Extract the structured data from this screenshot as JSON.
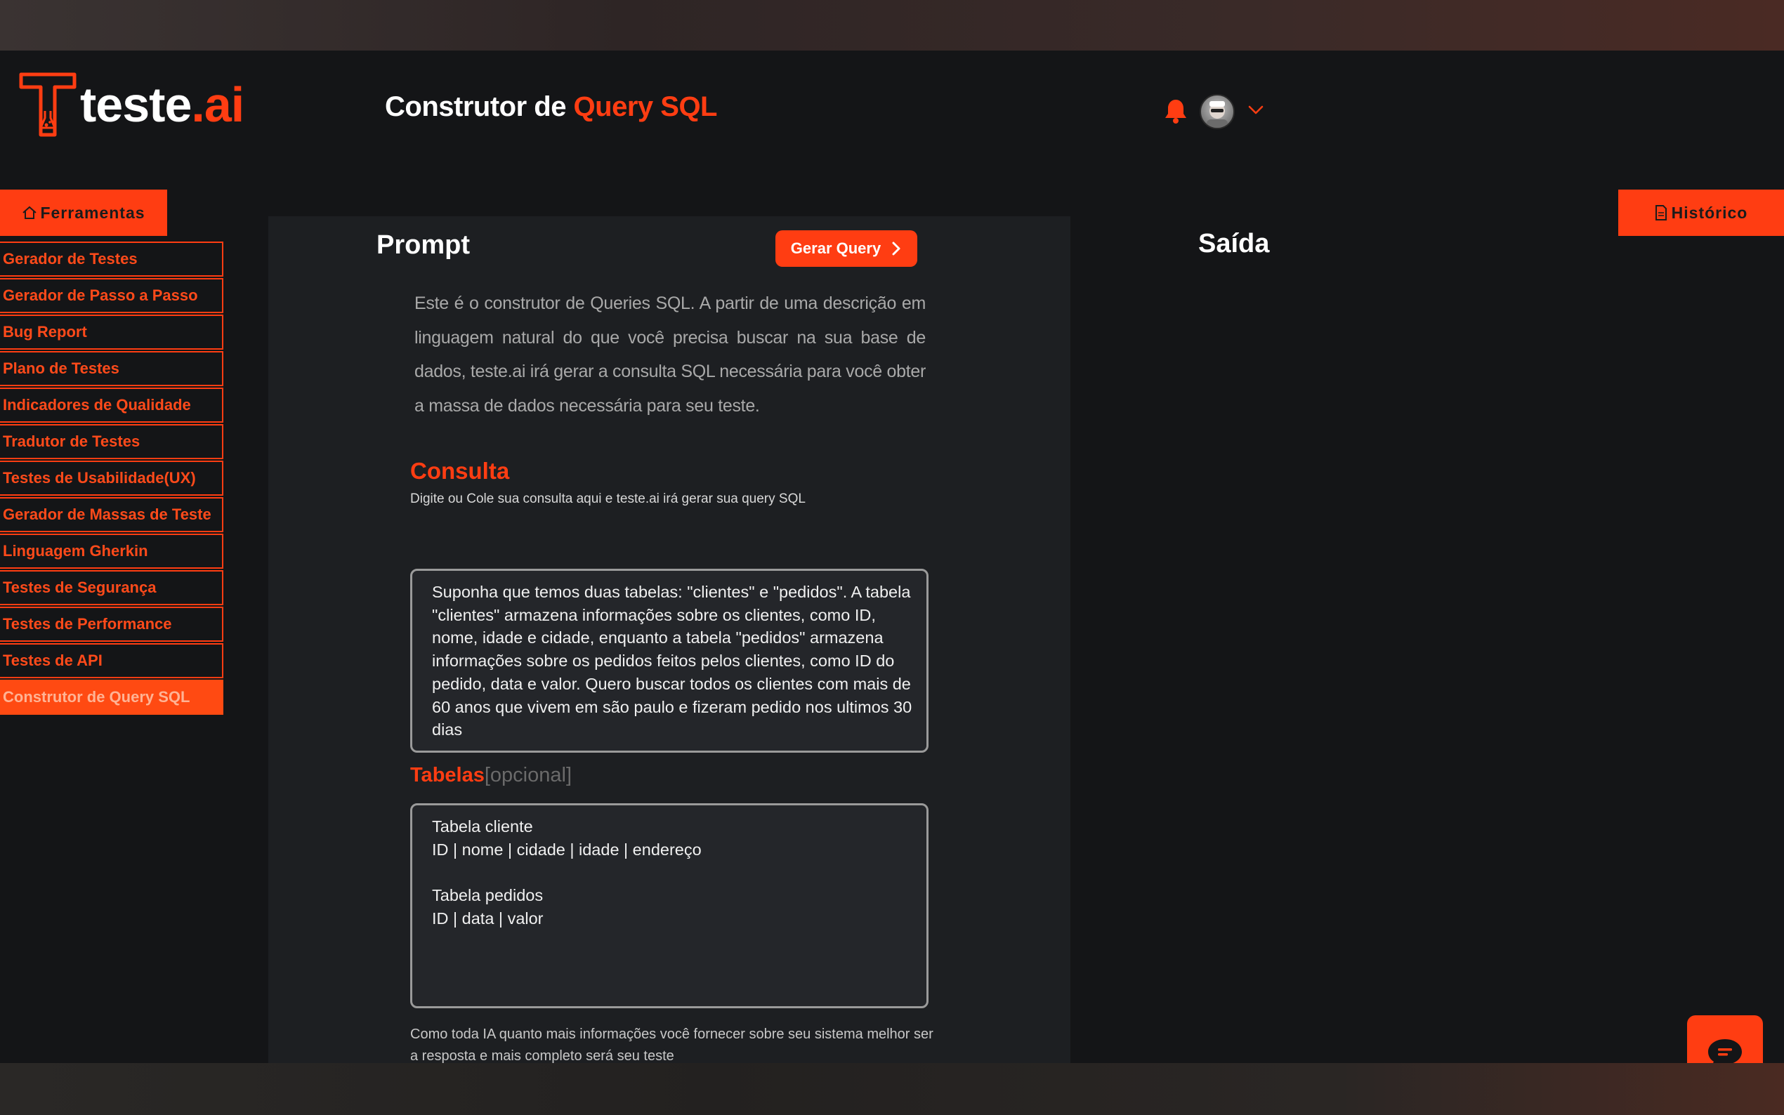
{
  "brand": {
    "name_prefix": "teste",
    "name_suffix": ".ai"
  },
  "header": {
    "title_prefix": "Construtor de ",
    "title_accent": "Query SQL"
  },
  "icons": {
    "logo": "logo-flask-icon",
    "notifications": "bell-icon",
    "user": "avatar",
    "user_menu": "chevron-down-icon",
    "tools": "home-icon",
    "history": "document-icon",
    "generate": "chevron-right-icon",
    "chat": "chat-bubble-icon"
  },
  "colors": {
    "accent": "#ff3d12",
    "background": "#141517",
    "panel": "#1d1f22"
  },
  "sidebar": {
    "tools_label": "Ferramentas",
    "items": [
      {
        "label": "Gerador de Testes"
      },
      {
        "label": "Gerador de Passo a Passo"
      },
      {
        "label": "Bug Report"
      },
      {
        "label": "Plano de Testes"
      },
      {
        "label": "Indicadores de Qualidade"
      },
      {
        "label": "Tradutor de Testes"
      },
      {
        "label": "Testes de Usabilidade(UX)"
      },
      {
        "label": "Gerador de Massas de Teste"
      },
      {
        "label": "Linguagem Gherkin"
      },
      {
        "label": "Testes de Segurança"
      },
      {
        "label": "Testes de Performance"
      },
      {
        "label": "Testes de API"
      },
      {
        "label": "Construtor de Query SQL",
        "active": true
      }
    ]
  },
  "prompt": {
    "title": "Prompt",
    "generate_label": "Gerar Query",
    "description": "Este é o construtor de Queries SQL. A partir de uma descrição em linguagem natural do que você precisa buscar na sua base de dados, teste.ai irá gerar a consulta SQL necessária para você obter a massa de dados necessária para seu teste.",
    "consulta": {
      "title": "Consulta",
      "hint": "Digite ou Cole sua consulta aqui e teste.ai irá gerar sua query SQL",
      "value": "Suponha que temos duas tabelas: \"clientes\" e \"pedidos\". A tabela \"clientes\" armazena informações sobre os clientes, como ID, nome, idade e cidade, enquanto a tabela \"pedidos\" armazena informações sobre os pedidos feitos pelos clientes, como ID do pedido, data e valor. Quero buscar todos os clientes com mais de 60 anos que vivem em são paulo e fizeram pedido nos ultimos 30 dias"
    },
    "tabelas": {
      "title": "Tabelas",
      "optional_tag": "[opcional]",
      "value": "Tabela cliente\nID | nome | cidade | idade | endereço\n\nTabela pedidos\nID | data | valor"
    },
    "footnote": "Como toda IA quanto mais informações você fornecer sobre seu sistema melhor ser a resposta e mais completo será seu teste"
  },
  "output": {
    "title": "Saída",
    "history_label": "Histórico"
  }
}
